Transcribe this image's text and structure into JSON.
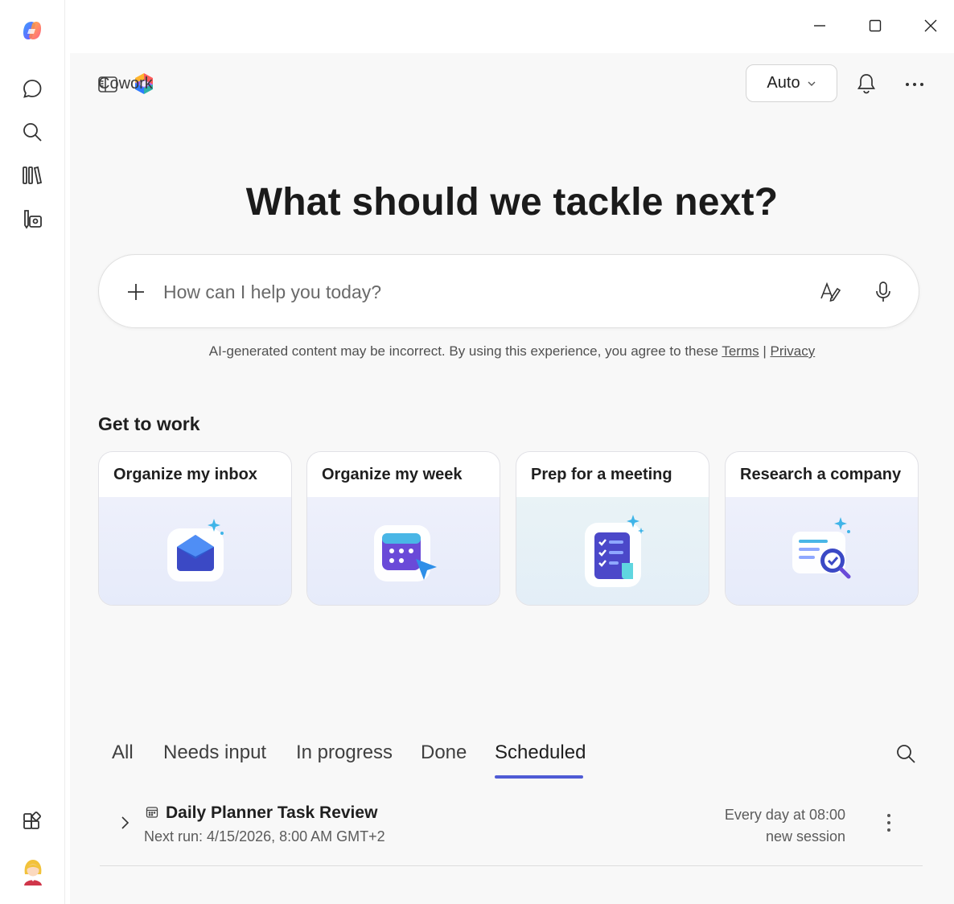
{
  "app": {
    "title": "Cowork"
  },
  "topbar": {
    "model_label": "Auto"
  },
  "hero": {
    "heading": "What should we tackle next?"
  },
  "composer": {
    "placeholder": "How can I help you today?"
  },
  "disclaimer": {
    "text": "AI-generated content may be incorrect. By using this experience, you agree to these ",
    "terms": "Terms",
    "separator": " | ",
    "privacy": "Privacy"
  },
  "get_to_work": {
    "title": "Get to work",
    "cards": [
      {
        "label": "Organize my inbox",
        "icon": "envelope-icon"
      },
      {
        "label": "Organize my week",
        "icon": "calendar-icon"
      },
      {
        "label": "Prep for a meeting",
        "icon": "checklist-icon"
      },
      {
        "label": "Research a company",
        "icon": "magnifier-document-icon"
      }
    ]
  },
  "tabs": [
    {
      "label": "All"
    },
    {
      "label": "Needs input"
    },
    {
      "label": "In progress"
    },
    {
      "label": "Done"
    },
    {
      "label": "Scheduled",
      "active": true
    }
  ],
  "tasks": [
    {
      "title": "Daily Planner Task Review",
      "next_run": "Next run: 4/15/2026, 8:00 AM GMT+2",
      "schedule": "Every day at 08:00",
      "session": "new session"
    }
  ],
  "colors": {
    "accent": "#4f5bd5",
    "background": "#f8f8f8"
  }
}
